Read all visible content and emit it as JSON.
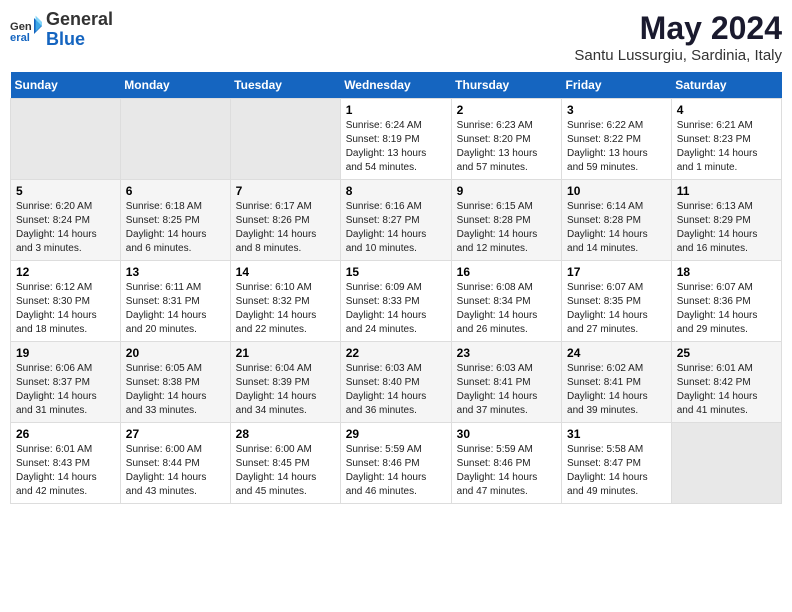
{
  "header": {
    "logo": {
      "general": "General",
      "blue": "Blue"
    },
    "title": "May 2024",
    "location": "Santu Lussurgiu, Sardinia, Italy"
  },
  "days_of_week": [
    "Sunday",
    "Monday",
    "Tuesday",
    "Wednesday",
    "Thursday",
    "Friday",
    "Saturday"
  ],
  "weeks": [
    [
      {
        "day": "",
        "empty": true
      },
      {
        "day": "",
        "empty": true
      },
      {
        "day": "",
        "empty": true
      },
      {
        "day": "1",
        "sunrise": "6:24 AM",
        "sunset": "8:19 PM",
        "daylight": "13 hours and 54 minutes."
      },
      {
        "day": "2",
        "sunrise": "6:23 AM",
        "sunset": "8:20 PM",
        "daylight": "13 hours and 57 minutes."
      },
      {
        "day": "3",
        "sunrise": "6:22 AM",
        "sunset": "8:22 PM",
        "daylight": "13 hours and 59 minutes."
      },
      {
        "day": "4",
        "sunrise": "6:21 AM",
        "sunset": "8:23 PM",
        "daylight": "14 hours and 1 minute."
      }
    ],
    [
      {
        "day": "5",
        "sunrise": "6:20 AM",
        "sunset": "8:24 PM",
        "daylight": "14 hours and 3 minutes."
      },
      {
        "day": "6",
        "sunrise": "6:18 AM",
        "sunset": "8:25 PM",
        "daylight": "14 hours and 6 minutes."
      },
      {
        "day": "7",
        "sunrise": "6:17 AM",
        "sunset": "8:26 PM",
        "daylight": "14 hours and 8 minutes."
      },
      {
        "day": "8",
        "sunrise": "6:16 AM",
        "sunset": "8:27 PM",
        "daylight": "14 hours and 10 minutes."
      },
      {
        "day": "9",
        "sunrise": "6:15 AM",
        "sunset": "8:28 PM",
        "daylight": "14 hours and 12 minutes."
      },
      {
        "day": "10",
        "sunrise": "6:14 AM",
        "sunset": "8:28 PM",
        "daylight": "14 hours and 14 minutes."
      },
      {
        "day": "11",
        "sunrise": "6:13 AM",
        "sunset": "8:29 PM",
        "daylight": "14 hours and 16 minutes."
      }
    ],
    [
      {
        "day": "12",
        "sunrise": "6:12 AM",
        "sunset": "8:30 PM",
        "daylight": "14 hours and 18 minutes."
      },
      {
        "day": "13",
        "sunrise": "6:11 AM",
        "sunset": "8:31 PM",
        "daylight": "14 hours and 20 minutes."
      },
      {
        "day": "14",
        "sunrise": "6:10 AM",
        "sunset": "8:32 PM",
        "daylight": "14 hours and 22 minutes."
      },
      {
        "day": "15",
        "sunrise": "6:09 AM",
        "sunset": "8:33 PM",
        "daylight": "14 hours and 24 minutes."
      },
      {
        "day": "16",
        "sunrise": "6:08 AM",
        "sunset": "8:34 PM",
        "daylight": "14 hours and 26 minutes."
      },
      {
        "day": "17",
        "sunrise": "6:07 AM",
        "sunset": "8:35 PM",
        "daylight": "14 hours and 27 minutes."
      },
      {
        "day": "18",
        "sunrise": "6:07 AM",
        "sunset": "8:36 PM",
        "daylight": "14 hours and 29 minutes."
      }
    ],
    [
      {
        "day": "19",
        "sunrise": "6:06 AM",
        "sunset": "8:37 PM",
        "daylight": "14 hours and 31 minutes."
      },
      {
        "day": "20",
        "sunrise": "6:05 AM",
        "sunset": "8:38 PM",
        "daylight": "14 hours and 33 minutes."
      },
      {
        "day": "21",
        "sunrise": "6:04 AM",
        "sunset": "8:39 PM",
        "daylight": "14 hours and 34 minutes."
      },
      {
        "day": "22",
        "sunrise": "6:03 AM",
        "sunset": "8:40 PM",
        "daylight": "14 hours and 36 minutes."
      },
      {
        "day": "23",
        "sunrise": "6:03 AM",
        "sunset": "8:41 PM",
        "daylight": "14 hours and 37 minutes."
      },
      {
        "day": "24",
        "sunrise": "6:02 AM",
        "sunset": "8:41 PM",
        "daylight": "14 hours and 39 minutes."
      },
      {
        "day": "25",
        "sunrise": "6:01 AM",
        "sunset": "8:42 PM",
        "daylight": "14 hours and 41 minutes."
      }
    ],
    [
      {
        "day": "26",
        "sunrise": "6:01 AM",
        "sunset": "8:43 PM",
        "daylight": "14 hours and 42 minutes."
      },
      {
        "day": "27",
        "sunrise": "6:00 AM",
        "sunset": "8:44 PM",
        "daylight": "14 hours and 43 minutes."
      },
      {
        "day": "28",
        "sunrise": "6:00 AM",
        "sunset": "8:45 PM",
        "daylight": "14 hours and 45 minutes."
      },
      {
        "day": "29",
        "sunrise": "5:59 AM",
        "sunset": "8:46 PM",
        "daylight": "14 hours and 46 minutes."
      },
      {
        "day": "30",
        "sunrise": "5:59 AM",
        "sunset": "8:46 PM",
        "daylight": "14 hours and 47 minutes."
      },
      {
        "day": "31",
        "sunrise": "5:58 AM",
        "sunset": "8:47 PM",
        "daylight": "14 hours and 49 minutes."
      },
      {
        "day": "",
        "empty": true
      }
    ]
  ],
  "labels": {
    "sunrise": "Sunrise:",
    "sunset": "Sunset:",
    "daylight": "Daylight hours"
  }
}
